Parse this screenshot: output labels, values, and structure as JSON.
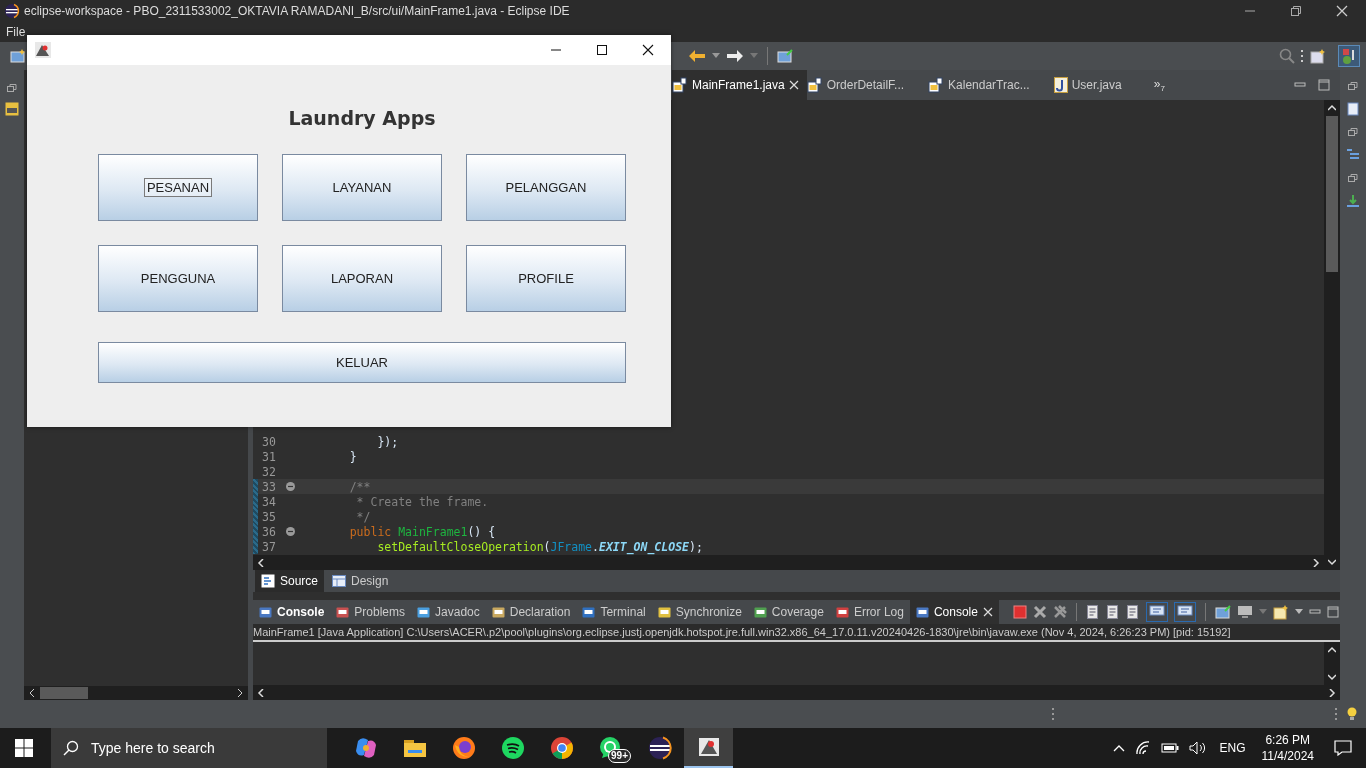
{
  "window": {
    "title": "eclipse-workspace - PBO_2311533002_OKTAVIA RAMADANI_B/src/ui/MainFrame1.java - Eclipse IDE"
  },
  "menu": [
    "File"
  ],
  "editor_tabs": [
    {
      "label": "MainFrame1.java",
      "kind": "design",
      "selected": true
    },
    {
      "label": "OrderDetailF...",
      "kind": "design",
      "selected": false
    },
    {
      "label": "KalendarTrac...",
      "kind": "design",
      "selected": false
    },
    {
      "label": "User.java",
      "kind": "java",
      "selected": false
    }
  ],
  "more_tabs": {
    "icon": "»",
    "count": "7"
  },
  "code_lines": [
    {
      "number": "30",
      "fold": false,
      "current": false,
      "tokens": [
        {
          "text": "        });",
          "kind": "plain"
        }
      ]
    },
    {
      "number": "31",
      "fold": false,
      "current": false,
      "tokens": [
        {
          "text": "    }",
          "kind": "plain"
        }
      ]
    },
    {
      "number": "32",
      "fold": false,
      "current": false
    },
    {
      "number": "33",
      "fold": true,
      "current": true,
      "tokens": [
        {
          "text": "    /**",
          "kind": "comment"
        }
      ]
    },
    {
      "number": "34",
      "fold": false,
      "current": false,
      "tokens": [
        {
          "text": "     * Create the frame.",
          "kind": "comment"
        }
      ]
    },
    {
      "number": "35",
      "fold": false,
      "current": false,
      "tokens": [
        {
          "text": "     */",
          "kind": "comment"
        }
      ]
    },
    {
      "number": "36",
      "fold": true,
      "current": false,
      "tokens": [
        {
          "text": "    public ",
          "kind": "keyword"
        },
        {
          "text": "MainFrame1",
          "kind": "declaration"
        },
        {
          "text": "() {",
          "kind": "plain"
        }
      ]
    },
    {
      "number": "37",
      "fold": false,
      "current": false,
      "tokens": [
        {
          "text": "        setDefaultCloseOperation",
          "kind": "method"
        },
        {
          "text": "(",
          "kind": "plain"
        },
        {
          "text": "JFrame",
          "kind": "class"
        },
        {
          "text": ".",
          "kind": "plain"
        },
        {
          "text": "EXIT_ON_CLOSE",
          "kind": "constant"
        },
        {
          "text": ");",
          "kind": "plain"
        }
      ]
    }
  ],
  "editor_modes": [
    {
      "label": "Source",
      "selected": true
    },
    {
      "label": "Design",
      "selected": false
    }
  ],
  "console_tabs": [
    {
      "label": "Console",
      "kind": "console",
      "bold": true,
      "selected": false
    },
    {
      "label": "Problems",
      "kind": "problems",
      "bold": false,
      "selected": false
    },
    {
      "label": "Javadoc",
      "kind": "javadoc",
      "bold": false,
      "selected": false
    },
    {
      "label": "Declaration",
      "kind": "declaration",
      "bold": false,
      "selected": false
    },
    {
      "label": "Terminal",
      "kind": "terminal",
      "bold": false,
      "selected": false
    },
    {
      "label": "Synchronize",
      "kind": "sync",
      "bold": false,
      "selected": false
    },
    {
      "label": "Coverage",
      "kind": "coverage",
      "bold": false,
      "selected": false
    },
    {
      "label": "Error Log",
      "kind": "errorlog",
      "bold": false,
      "selected": false
    },
    {
      "label": "Console",
      "kind": "console",
      "bold": false,
      "selected": true
    }
  ],
  "console": {
    "process": "MainFrame1 [Java Application] C:\\Users\\ACER\\.p2\\pool\\plugins\\org.eclipse.justj.openjdk.hotspot.jre.full.win32.x86_64_17.0.11.v20240426-1830\\jre\\bin\\javaw.exe  (Nov 4, 2024, 6:26:23 PM) [pid: 15192]"
  },
  "app_window": {
    "heading": "Laundry Apps",
    "buttons": [
      {
        "label": "PESANAN",
        "focused": true
      },
      {
        "label": "LAYANAN",
        "focused": false
      },
      {
        "label": "PELANGGAN",
        "focused": false
      },
      {
        "label": "PENGGUNA",
        "focused": false
      },
      {
        "label": "LAPORAN",
        "focused": false
      },
      {
        "label": "PROFILE",
        "focused": false
      }
    ],
    "exit_button": {
      "label": "KELUAR",
      "focused": false
    }
  },
  "taskbar": {
    "search_placeholder": "Type here to search",
    "apps": [
      {
        "kind": "copilot",
        "selected": false
      },
      {
        "kind": "folder",
        "selected": false
      },
      {
        "kind": "firefox",
        "selected": false
      },
      {
        "kind": "spotify",
        "selected": false
      },
      {
        "kind": "chrome",
        "selected": false
      },
      {
        "kind": "whatsapp",
        "selected": false,
        "badge": "99+"
      },
      {
        "kind": "eclipse",
        "selected": false
      },
      {
        "kind": "java",
        "selected": true
      }
    ],
    "language": "ENG",
    "time": "6:26 PM",
    "date": "11/4/2024"
  }
}
